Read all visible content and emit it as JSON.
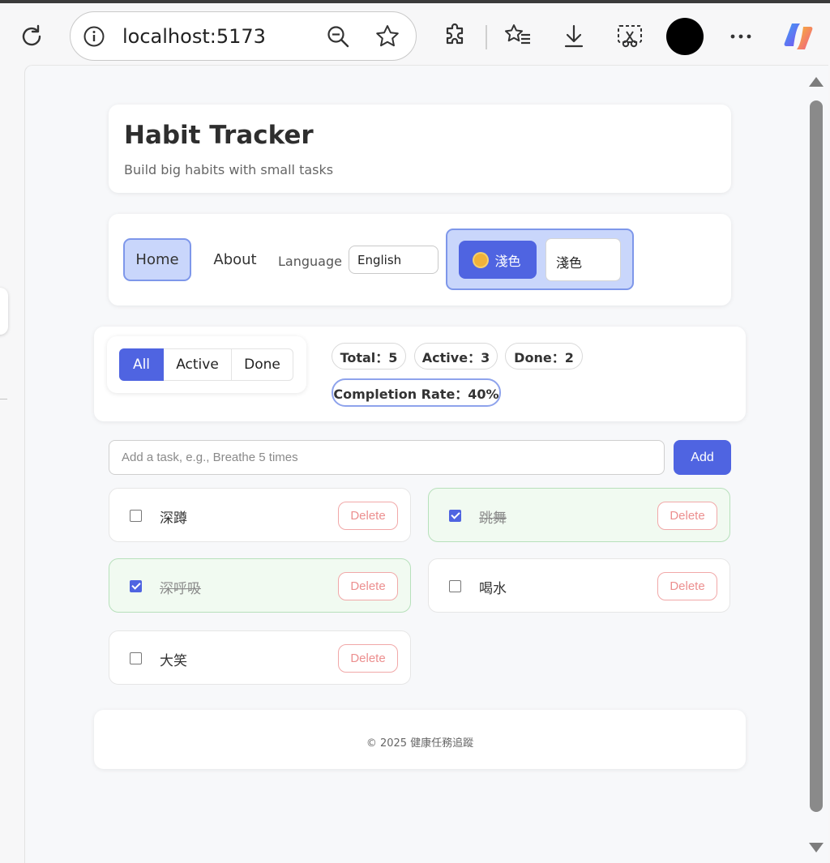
{
  "browser": {
    "url": "localhost:5173",
    "icons": [
      "reload-icon",
      "info-icon",
      "zoom-out-icon",
      "star-icon",
      "extensions-icon",
      "favorites-icon",
      "download-icon",
      "screenshot-icon",
      "more-icon",
      "copilot-icon"
    ]
  },
  "header": {
    "title": "Habit Tracker",
    "subtitle": "Build big habits with small tasks"
  },
  "nav": {
    "home": "Home",
    "about": "About",
    "language_label": "Language",
    "language_value": "English",
    "theme_button": "淺色",
    "theme_value": "淺色"
  },
  "filters": {
    "all": "All",
    "active": "Active",
    "done": "Done",
    "selected": "All"
  },
  "stats": {
    "total": "Total：5",
    "active": "Active：3",
    "done": "Done：2",
    "rate": "Completion Rate：40%"
  },
  "add_task": {
    "placeholder": "Add a task, e.g., Breathe 5 times",
    "button": "Add"
  },
  "tasks": [
    {
      "label": "深蹲",
      "done": false,
      "delete": "Delete"
    },
    {
      "label": "跳舞",
      "done": true,
      "delete": "Delete"
    },
    {
      "label": "深呼吸",
      "done": true,
      "delete": "Delete"
    },
    {
      "label": "喝水",
      "done": false,
      "delete": "Delete"
    },
    {
      "label": "大笑",
      "done": false,
      "delete": "Delete"
    }
  ],
  "footer": {
    "text": "© 2025 健康任務追蹤"
  },
  "colors": {
    "accent": "#4f64e1",
    "accent_light": "#c9d6fb",
    "done_bg": "#f1faf1",
    "delete": "#ec8f8f"
  }
}
